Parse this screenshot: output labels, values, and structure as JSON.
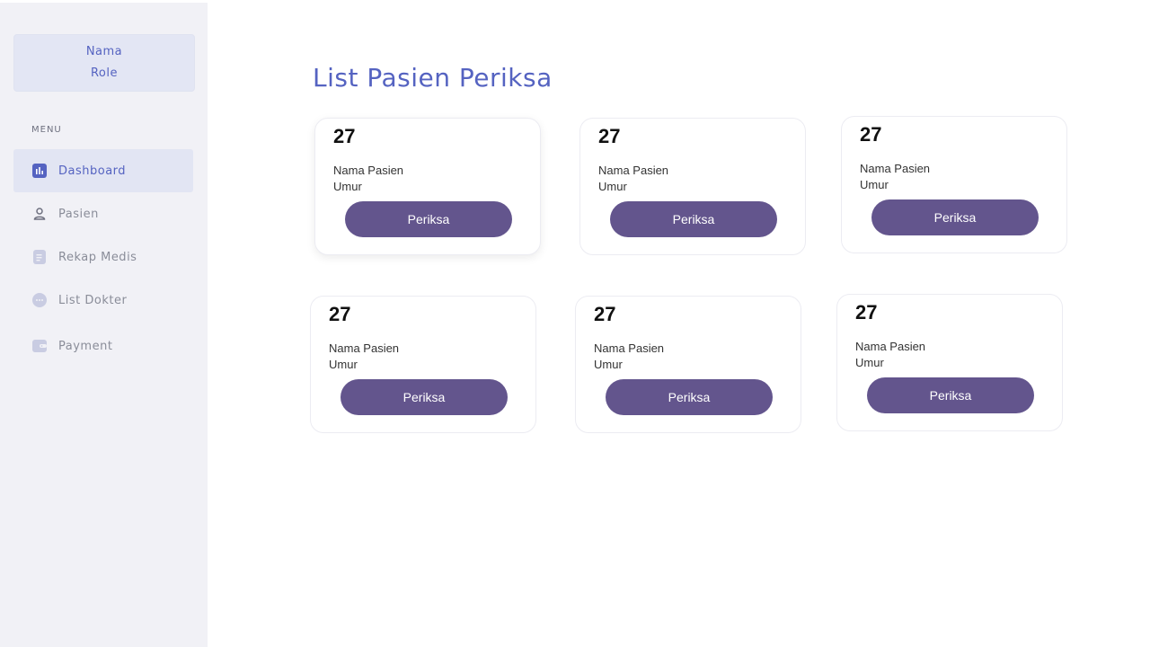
{
  "sidebar": {
    "profile": {
      "name": "Nama",
      "role": "Role"
    },
    "menu_heading": "MENU",
    "items": [
      {
        "label": "Dashboard",
        "icon": "dashboard-icon",
        "active": true
      },
      {
        "label": "Pasien",
        "icon": "user-icon",
        "active": false
      },
      {
        "label": "Rekap Medis",
        "icon": "document-icon",
        "active": false
      },
      {
        "label": "List Dokter",
        "icon": "chat-icon",
        "active": false
      },
      {
        "label": "Payment",
        "icon": "wallet-icon",
        "active": false
      }
    ]
  },
  "main": {
    "title": "List Pasien Periksa",
    "cards": [
      {
        "number": "27",
        "name_label": "Nama Pasien",
        "age_label": "Umur",
        "button_label": "Periksa"
      },
      {
        "number": "27",
        "name_label": "Nama Pasien",
        "age_label": "Umur",
        "button_label": "Periksa"
      },
      {
        "number": "27",
        "name_label": "Nama Pasien",
        "age_label": "Umur",
        "button_label": "Periksa"
      },
      {
        "number": "27",
        "name_label": "Nama Pasien",
        "age_label": "Umur",
        "button_label": "Periksa"
      },
      {
        "number": "27",
        "name_label": "Nama Pasien",
        "age_label": "Umur",
        "button_label": "Periksa"
      },
      {
        "number": "27",
        "name_label": "Nama Pasien",
        "age_label": "Umur",
        "button_label": "Periksa"
      }
    ]
  },
  "colors": {
    "accent": "#5563c1",
    "button": "#63558d",
    "sidebar_bg": "#f1f1f6",
    "active_bg": "#e2e5f3"
  }
}
